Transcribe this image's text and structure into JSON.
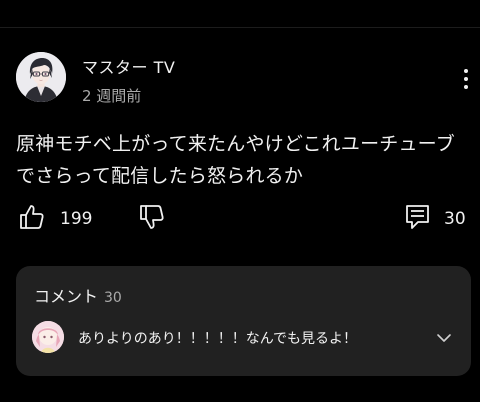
{
  "post": {
    "channel_name": "マスター TV",
    "time_ago": "2 週間前",
    "text_line1": "原神モチベ上がって来たんやけどこれユーチューブ",
    "text_line2": "でさらって配信したら怒られるか"
  },
  "actions": {
    "like_count": "199",
    "comment_count": "30"
  },
  "comments": {
    "label": "コメント",
    "count": "30",
    "top_comment": "ありよりのあり！！！！！なんでも見るよ！"
  },
  "icons": {
    "menu": "more-vert-icon",
    "like": "thumb-up-icon",
    "dislike": "thumb-down-icon",
    "comment": "comment-icon",
    "expand": "chevron-down-icon"
  },
  "colors": {
    "background": "#000000",
    "text_primary": "#f1f1f1",
    "text_secondary": "#aaaaaa",
    "card_background": "#212121"
  }
}
